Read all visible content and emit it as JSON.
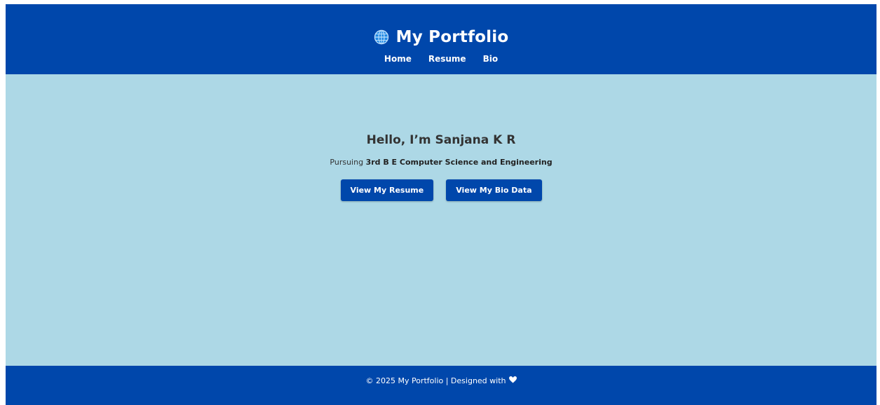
{
  "header": {
    "icon": "globe-icon",
    "title": "My Portfolio",
    "nav": [
      {
        "label": "Home"
      },
      {
        "label": "Resume"
      },
      {
        "label": "Bio"
      }
    ]
  },
  "hero": {
    "greeting": "Hello, I’m Sanjana K R",
    "pursuing_prefix": "Pursuing",
    "pursuing_course": "3rd B E Computer Science and Engineering",
    "buttons": {
      "resume": "View My Resume",
      "bio": "View My Bio Data"
    }
  },
  "footer": {
    "text": "© 2025 My Portfolio | Designed with",
    "icon": "heart-icon"
  },
  "colors": {
    "primary": "#0047ab",
    "background": "#add8e6",
    "text": "#333333"
  }
}
